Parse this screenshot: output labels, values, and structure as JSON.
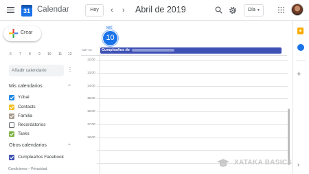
{
  "header": {
    "app_title": "Calendar",
    "logo_day": "31",
    "today_button": "Hoy",
    "month_label": "Abril de 2019",
    "view_selector": "Día"
  },
  "sidebar": {
    "create_label": "Crear",
    "mini_weekdays": [
      "6",
      "7",
      "8",
      "9",
      "10",
      "11",
      "12"
    ],
    "add_calendar_placeholder": "Añadir calendario",
    "my_calendars_title": "Mis calendarios",
    "my_calendars": [
      {
        "label": "Yúbal",
        "color": "#1e88e5",
        "checked": true
      },
      {
        "label": "Contacts",
        "color": "#f6bf26",
        "checked": true
      },
      {
        "label": "Familia",
        "color": "#a79b8e",
        "checked": true
      },
      {
        "label": "Recordatorios",
        "color": "#616161",
        "checked": false
      },
      {
        "label": "Tasks",
        "color": "#7cb342",
        "checked": true
      }
    ],
    "other_calendars_title": "Otros calendarios",
    "other_calendars": [
      {
        "label": "Cumpleaños Facebook",
        "color": "#3f51b5",
        "checked": true
      }
    ],
    "footer": "Condiciones – Privacidad"
  },
  "day_view": {
    "weekday": "MIÉ",
    "day_number": "10",
    "timezone": "GMT+02",
    "allday_event": "Cumpleaños de",
    "event_color": "#3f51b5",
    "hours": [
      "12:00",
      "13:00",
      "14:00",
      "15:00",
      "16:00",
      "17:00",
      "18:00"
    ]
  },
  "watermark": {
    "text": "XATAKA BASICS"
  },
  "icons": {
    "menu": "menu-icon",
    "search": "search-icon",
    "settings": "gear-icon",
    "apps": "apps-grid-icon",
    "keep": "keep-icon",
    "tasks": "tasks-icon"
  }
}
